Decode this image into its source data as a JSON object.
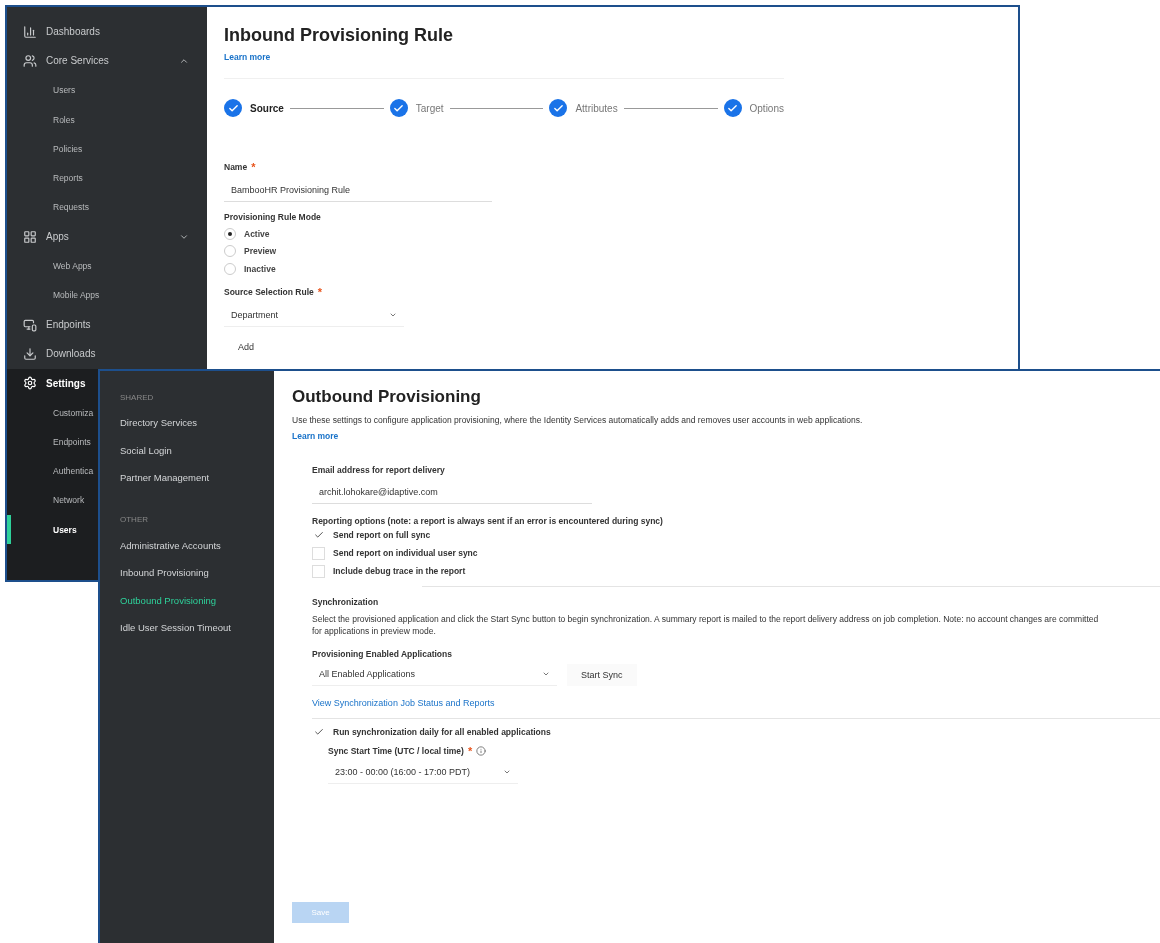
{
  "back_window": {
    "sidebar": {
      "items": [
        {
          "label": "Dashboards",
          "selected": false
        },
        {
          "label": "Core Services",
          "selected": false,
          "expanded": true,
          "children": [
            {
              "label": "Users",
              "selected": false
            },
            {
              "label": "Roles",
              "selected": false
            },
            {
              "label": "Policies",
              "selected": false
            },
            {
              "label": "Reports",
              "selected": false
            },
            {
              "label": "Requests",
              "selected": false
            }
          ]
        },
        {
          "label": "Apps",
          "selected": false,
          "expanded": false,
          "children": [
            {
              "label": "Web Apps",
              "selected": false
            },
            {
              "label": "Mobile Apps",
              "selected": false
            }
          ]
        },
        {
          "label": "Endpoints",
          "selected": false
        },
        {
          "label": "Downloads",
          "selected": false
        },
        {
          "label": "Settings",
          "selected": true,
          "children": [
            {
              "label": "Customiza",
              "selected": false
            },
            {
              "label": "Endpoints",
              "selected": false
            },
            {
              "label": "Authentica",
              "selected": false
            },
            {
              "label": "Network",
              "selected": false
            },
            {
              "label": "Users",
              "selected": true
            }
          ]
        }
      ]
    },
    "title": "Inbound Provisioning Rule",
    "learn_more": "Learn more",
    "steps": [
      {
        "label": "Source",
        "selected": true
      },
      {
        "label": "Target",
        "selected": false
      },
      {
        "label": "Attributes",
        "selected": false
      },
      {
        "label": "Options",
        "selected": false
      }
    ],
    "name_field": {
      "label": "Name",
      "required_mark": "*",
      "value": "BambooHR Provisioning Rule"
    },
    "mode": {
      "label": "Provisioning Rule Mode",
      "options": [
        {
          "label": "Active",
          "selected": true
        },
        {
          "label": "Preview",
          "selected": false
        },
        {
          "label": "Inactive",
          "selected": false
        }
      ]
    },
    "source_rule": {
      "label": "Source Selection Rule",
      "required_mark": "*",
      "value": "Department"
    },
    "add_button": "Add"
  },
  "front_window": {
    "sidebar": {
      "sections": [
        {
          "heading": "SHARED",
          "items": [
            {
              "label": "Directory Services",
              "selected": false
            },
            {
              "label": "Social Login",
              "selected": false
            },
            {
              "label": "Partner Management",
              "selected": false
            }
          ]
        },
        {
          "heading": "OTHER",
          "items": [
            {
              "label": "Administrative Accounts",
              "selected": false
            },
            {
              "label": "Inbound Provisioning",
              "selected": false
            },
            {
              "label": "Outbound Provisioning",
              "selected": true
            },
            {
              "label": "Idle User Session Timeout",
              "selected": false
            }
          ]
        }
      ]
    },
    "title": "Outbound Provisioning",
    "description": "Use these settings to configure application provisioning, where the Identity Services automatically adds and removes user accounts in web applications.",
    "learn_more": "Learn more",
    "email": {
      "label": "Email address for report delivery",
      "value": "archit.lohokare@idaptive.com"
    },
    "reporting": {
      "label": "Reporting options (note: a report is always sent if an error is encountered during sync)",
      "options": [
        {
          "label": "Send report on full sync",
          "checked": true
        },
        {
          "label": "Send report on individual user sync",
          "checked": false
        },
        {
          "label": "Include debug trace in the report",
          "checked": false
        }
      ]
    },
    "sync": {
      "heading": "Synchronization",
      "description_lines": [
        "Select the provisioned application and click the Start Sync button to begin synchronization. A summary report is mailed to the report delivery address on job completion. Note: no account changes are committed",
        "for applications in preview mode."
      ]
    },
    "applications": {
      "label": "Provisioning Enabled Applications",
      "value": "All Enabled Applications",
      "button": "Start Sync"
    },
    "status_link": "View Synchronization Job Status and Reports",
    "daily": {
      "label": "Run synchronization daily for all enabled applications",
      "checked": true
    },
    "start_time": {
      "label": "Sync Start Time (UTC / local time)",
      "required_mark": "*",
      "value": "23:00 - 00:00 (16:00 - 17:00 PDT)"
    },
    "save_button": {
      "label": "Save",
      "disabled": true
    }
  }
}
